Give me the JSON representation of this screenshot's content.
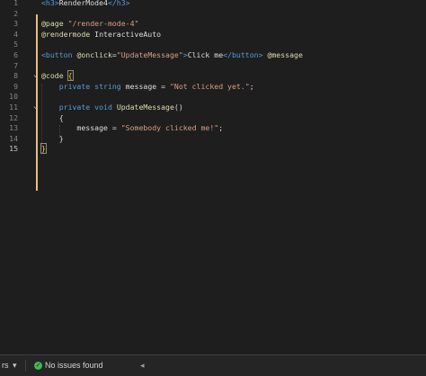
{
  "editor": {
    "lines": [
      {
        "num": "1",
        "parts": [
          [
            "c-tag",
            "<h3>"
          ],
          [
            "c-text",
            "RenderMode4"
          ],
          [
            "c-tag",
            "</h3>"
          ]
        ]
      },
      {
        "num": "2",
        "parts": []
      },
      {
        "num": "3",
        "parts": [
          [
            "c-razor",
            "@page "
          ],
          [
            "c-str",
            "\"/render-mode-4\""
          ]
        ]
      },
      {
        "num": "4",
        "parts": [
          [
            "c-razor",
            "@rendermode "
          ],
          [
            "c-text",
            "InteractiveAuto"
          ]
        ]
      },
      {
        "num": "5",
        "parts": []
      },
      {
        "num": "6",
        "parts": [
          [
            "c-tag",
            "<button "
          ],
          [
            "c-razor",
            "@onclick"
          ],
          [
            "c-text",
            "="
          ],
          [
            "c-str",
            "\"UpdateMessage\""
          ],
          [
            "c-tag",
            ">"
          ],
          [
            "c-text",
            "Click me"
          ],
          [
            "c-tag",
            "</button>"
          ],
          [
            "c-text",
            " "
          ],
          [
            "c-razor",
            "@message"
          ]
        ]
      },
      {
        "num": "7",
        "parts": []
      },
      {
        "num": "8",
        "parts": [
          [
            "c-razor",
            "@code "
          ],
          [
            "c-brace",
            "{"
          ]
        ]
      },
      {
        "num": "9",
        "parts": [
          [
            "c-text",
            "    "
          ],
          [
            "c-kw",
            "private "
          ],
          [
            "c-kw",
            "string "
          ],
          [
            "c-text",
            "message = "
          ],
          [
            "c-str",
            "\"Not clicked yet.\""
          ],
          [
            "c-text",
            ";"
          ]
        ]
      },
      {
        "num": "10",
        "parts": []
      },
      {
        "num": "11",
        "parts": [
          [
            "c-text",
            "    "
          ],
          [
            "c-kw",
            "private "
          ],
          [
            "c-kw",
            "void "
          ],
          [
            "c-method",
            "UpdateMessage"
          ],
          [
            "c-text",
            "()"
          ]
        ]
      },
      {
        "num": "12",
        "parts": [
          [
            "c-text",
            "    {"
          ]
        ]
      },
      {
        "num": "13",
        "parts": [
          [
            "c-text",
            "        message = "
          ],
          [
            "c-str",
            "\"Somebody clicked me!\""
          ],
          [
            "c-text",
            ";"
          ]
        ]
      },
      {
        "num": "14",
        "parts": [
          [
            "c-text",
            "    }"
          ]
        ]
      },
      {
        "num": "15",
        "parts": [
          [
            "c-brace",
            "}"
          ]
        ]
      }
    ],
    "active_line": "15"
  },
  "statusbar": {
    "left_partial": "rs",
    "dropdown_glyph": "▾",
    "issues_text": "No issues found",
    "nav_glyph": "◂"
  }
}
